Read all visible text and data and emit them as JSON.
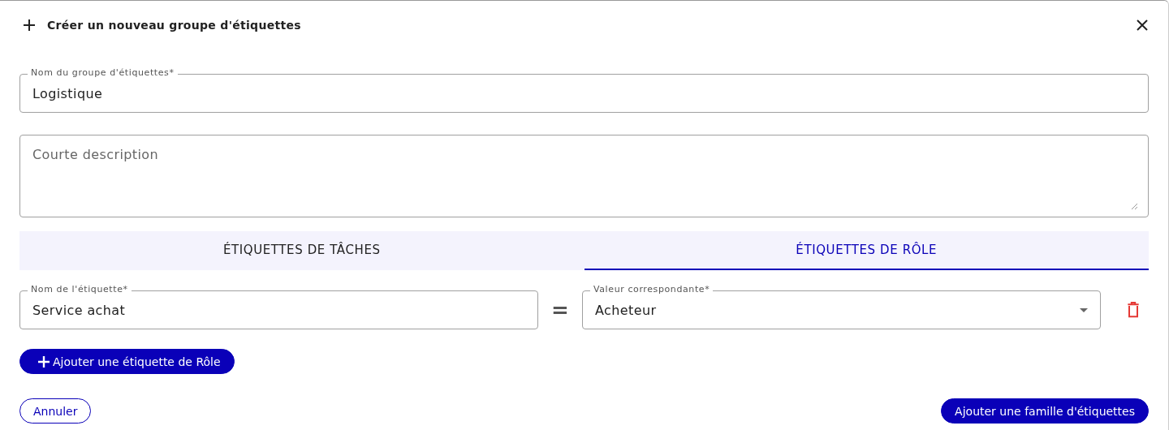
{
  "dialog": {
    "title": "Créer un nouveau groupe d'étiquettes"
  },
  "name_field": {
    "label": "Nom du groupe d'étiquettes*",
    "value": "Logistique"
  },
  "description_field": {
    "placeholder": "Courte description"
  },
  "tabs": [
    {
      "label": "ÉTIQUETTES DE TÂCHES",
      "selected": false
    },
    {
      "label": "ÉTIQUETTES DE RÔLE",
      "selected": true
    }
  ],
  "tag_rows": [
    {
      "name_label": "Nom de l'étiquette*",
      "name_value": "Service achat",
      "value_label": "Valeur correspondante*",
      "value": "Acheteur",
      "operator": "="
    }
  ],
  "add_tag_button": "Ajouter une étiquette de Rôle",
  "footer": {
    "cancel": "Annuler",
    "submit": "Ajouter une famille d'étiquettes"
  }
}
